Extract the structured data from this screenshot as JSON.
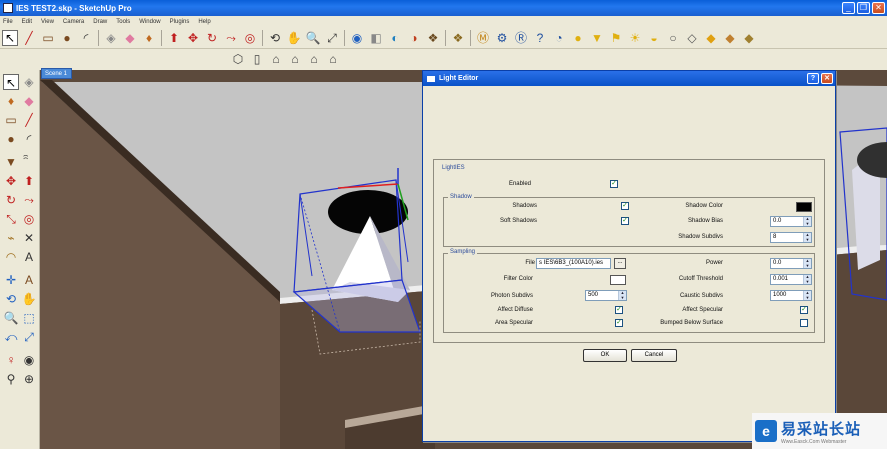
{
  "window": {
    "title": "IES TEST2.skp - SketchUp Pro",
    "minimize": "_",
    "restore": "❐",
    "close": "✕"
  },
  "menu": [
    "File",
    "Edit",
    "View",
    "Camera",
    "Draw",
    "Tools",
    "Window",
    "Plugins",
    "Help"
  ],
  "toolbar_main": [
    {
      "name": "select-icon",
      "glyph": "↖",
      "color": "#000000"
    },
    {
      "name": "line-icon",
      "glyph": "╱",
      "color": "#c02020"
    },
    {
      "name": "rectangle-icon",
      "glyph": "▭",
      "color": "#7a4a20"
    },
    {
      "name": "circle-icon",
      "glyph": "●",
      "color": "#7a4a20"
    },
    {
      "name": "arc-icon",
      "glyph": "◜",
      "color": "#333333"
    },
    {
      "name": "make-component-icon",
      "glyph": "◈",
      "color": "#888888"
    },
    {
      "name": "eraser-icon",
      "glyph": "◆",
      "color": "#e07aa0"
    },
    {
      "name": "paint-bucket-icon",
      "glyph": "♦",
      "color": "#c06a20"
    },
    {
      "name": "push-pull-icon",
      "glyph": "⬆",
      "color": "#c02020"
    },
    {
      "name": "move-icon",
      "glyph": "✥",
      "color": "#c02020"
    },
    {
      "name": "rotate-icon",
      "glyph": "↻",
      "color": "#c02020"
    },
    {
      "name": "follow-me-icon",
      "glyph": "⤳",
      "color": "#c02020"
    },
    {
      "name": "offset-icon",
      "glyph": "◎",
      "color": "#c02020"
    },
    {
      "name": "orbit-icon",
      "glyph": "⟲",
      "color": "#333333"
    },
    {
      "name": "pan-icon",
      "glyph": "✋",
      "color": "#333333"
    },
    {
      "name": "zoom-icon",
      "glyph": "🔍",
      "color": "#333333"
    },
    {
      "name": "zoom-extents-icon",
      "glyph": "⤢",
      "color": "#333333"
    },
    {
      "name": "get-models-icon",
      "glyph": "◉",
      "color": "#2060c0"
    },
    {
      "name": "share-model-icon",
      "glyph": "◧",
      "color": "#888888"
    },
    {
      "name": "get-photo-texture-icon",
      "glyph": "◐",
      "color": "#2080c0"
    },
    {
      "name": "share-component-icon",
      "glyph": "◑",
      "color": "#c04020"
    },
    {
      "name": "warehouse-icon",
      "glyph": "❖",
      "color": "#6a4a20"
    },
    {
      "name": "extension-warehouse-icon",
      "glyph": "❖",
      "color": "#8a6a20"
    },
    {
      "name": "vray-material-editor-icon",
      "glyph": "Ⓜ",
      "color": "#c08010"
    },
    {
      "name": "vray-options-icon",
      "glyph": "⚙",
      "color": "#2050a0"
    },
    {
      "name": "vray-render-icon",
      "glyph": "Ⓡ",
      "color": "#2050a0"
    },
    {
      "name": "vray-help-icon",
      "glyph": "?",
      "color": "#2050a0"
    },
    {
      "name": "vray-frame-buffer-icon",
      "glyph": "◔",
      "color": "#2050a0"
    },
    {
      "name": "vray-sphere-light-icon",
      "glyph": "●",
      "color": "#e0b010"
    },
    {
      "name": "vray-spot-light-icon",
      "glyph": "▼",
      "color": "#e0b010"
    },
    {
      "name": "vray-ies-light-icon",
      "glyph": "⚑",
      "color": "#e0b010"
    },
    {
      "name": "vray-omni-light-icon",
      "glyph": "☀",
      "color": "#e0b010"
    },
    {
      "name": "vray-dome-light-icon",
      "glyph": "◒",
      "color": "#e0b010"
    },
    {
      "name": "vray-sphere-icon",
      "glyph": "○",
      "color": "#555555"
    },
    {
      "name": "vray-plane-icon",
      "glyph": "◇",
      "color": "#555555"
    },
    {
      "name": "vray-proxy-icon",
      "glyph": "◆",
      "color": "#e0a010"
    },
    {
      "name": "vray-export-proxy-icon",
      "glyph": "◆",
      "color": "#c08030"
    },
    {
      "name": "vray-import-proxy-icon",
      "glyph": "◆",
      "color": "#a08030"
    }
  ],
  "toolbar_views": [
    {
      "name": "iso-view-icon",
      "glyph": "⬡"
    },
    {
      "name": "top-view-icon",
      "glyph": "▯"
    },
    {
      "name": "front-view-icon",
      "glyph": "⌂"
    },
    {
      "name": "right-view-icon",
      "glyph": "⌂"
    },
    {
      "name": "back-view-icon",
      "glyph": "⌂"
    },
    {
      "name": "left-view-icon",
      "glyph": "⌂"
    }
  ],
  "left_palette": [
    {
      "name": "select-icon",
      "glyph": "↖",
      "color": "#000000"
    },
    {
      "name": "make-component-icon",
      "glyph": "◈",
      "color": "#888888"
    },
    {
      "name": "paint-bucket-icon",
      "glyph": "♦",
      "color": "#c06a20"
    },
    {
      "name": "eraser-icon",
      "glyph": "◆",
      "color": "#e07aa0"
    },
    {
      "name": "rectangle-icon",
      "glyph": "▭",
      "color": "#7a4a20"
    },
    {
      "name": "line-icon",
      "glyph": "╱",
      "color": "#c02020"
    },
    {
      "name": "circle-icon",
      "glyph": "●",
      "color": "#7a4a20"
    },
    {
      "name": "arc-icon",
      "glyph": "◜",
      "color": "#333333"
    },
    {
      "name": "polygon-icon",
      "glyph": "▼",
      "color": "#7a4a20"
    },
    {
      "name": "freehand-icon",
      "glyph": "ꩰ",
      "color": "#333333"
    },
    {
      "name": "move-icon",
      "glyph": "✥",
      "color": "#c02020"
    },
    {
      "name": "push-pull-icon",
      "glyph": "⬆",
      "color": "#c02020"
    },
    {
      "name": "rotate-icon",
      "glyph": "↻",
      "color": "#c02020"
    },
    {
      "name": "follow-me-icon",
      "glyph": "⤳",
      "color": "#c02020"
    },
    {
      "name": "scale-icon",
      "glyph": "⤡",
      "color": "#c02020"
    },
    {
      "name": "offset-icon",
      "glyph": "◎",
      "color": "#c02020"
    },
    {
      "name": "tape-measure-icon",
      "glyph": "⌁",
      "color": "#a07020"
    },
    {
      "name": "dimension-icon",
      "glyph": "✕",
      "color": "#333333"
    },
    {
      "name": "protractor-icon",
      "glyph": "◠",
      "color": "#a07020"
    },
    {
      "name": "text-icon",
      "glyph": "A",
      "color": "#333333"
    },
    {
      "name": "axes-icon",
      "glyph": "✛",
      "color": "#2060c0"
    },
    {
      "name": "3d-text-icon",
      "glyph": "A",
      "color": "#7a4a20"
    },
    {
      "name": "orbit-icon",
      "glyph": "⟲",
      "color": "#2060c0"
    },
    {
      "name": "pan-icon",
      "glyph": "✋",
      "color": "#333333"
    },
    {
      "name": "zoom-icon",
      "glyph": "🔍",
      "color": "#2060c0"
    },
    {
      "name": "zoom-window-icon",
      "glyph": "⬚",
      "color": "#2060c0"
    },
    {
      "name": "previous-view-icon",
      "glyph": "⤺",
      "color": "#2060c0"
    },
    {
      "name": "zoom-extents-icon",
      "glyph": "⤢",
      "color": "#2060c0"
    },
    {
      "name": "position-camera-icon",
      "glyph": "♀",
      "color": "#c02020"
    },
    {
      "name": "look-around-icon",
      "glyph": "◉",
      "color": "#333333"
    },
    {
      "name": "walk-icon",
      "glyph": "⚲",
      "color": "#333333"
    },
    {
      "name": "section-plane-icon",
      "glyph": "⊕",
      "color": "#333333"
    }
  ],
  "scene_tab": "Scene 1",
  "dialog": {
    "title": "Light Editor",
    "help": "?",
    "close": "✕",
    "group_title": "LightIES",
    "enabled": {
      "label": "Enabled",
      "checked": true
    },
    "shadow": {
      "title": "Shadow",
      "shadows": {
        "label": "Shadows",
        "checked": true
      },
      "soft_shadows": {
        "label": "Soft Shadows",
        "checked": true
      },
      "shadow_color": {
        "label": "Shadow Color",
        "color": "#000000"
      },
      "shadow_bias": {
        "label": "Shadow Bias",
        "value": "0.0"
      },
      "shadow_subdivs": {
        "label": "Shadow Subdivs",
        "value": "8"
      }
    },
    "sampling": {
      "title": "Sampling",
      "file": {
        "label": "File",
        "value": "s IES\\6B3_(100A10).ies",
        "browse": "..."
      },
      "power": {
        "label": "Power",
        "value": "0.0"
      },
      "filter_color": {
        "label": "Filter Color",
        "color": "#ffffff"
      },
      "cutoff": {
        "label": "Cutoff Threshold",
        "value": "0.001"
      },
      "photon_subdivs": {
        "label": "Photon Subdivs",
        "value": "500"
      },
      "caustic_subdivs": {
        "label": "Caustic Subdivs",
        "value": "1000"
      },
      "affect_diffuse": {
        "label": "Affect Diffuse",
        "checked": true
      },
      "affect_specular": {
        "label": "Affect Specular",
        "checked": true
      },
      "area_specular": {
        "label": "Area Specular",
        "checked": true
      },
      "bumped_below": {
        "label": "Bumped Below Surface",
        "checked": false
      }
    },
    "ok": "OK",
    "cancel": "Cancel"
  },
  "watermark": {
    "logo": "e",
    "title": "易采站长站",
    "subtitle": "Www.Easck.Com  Webmaster"
  }
}
